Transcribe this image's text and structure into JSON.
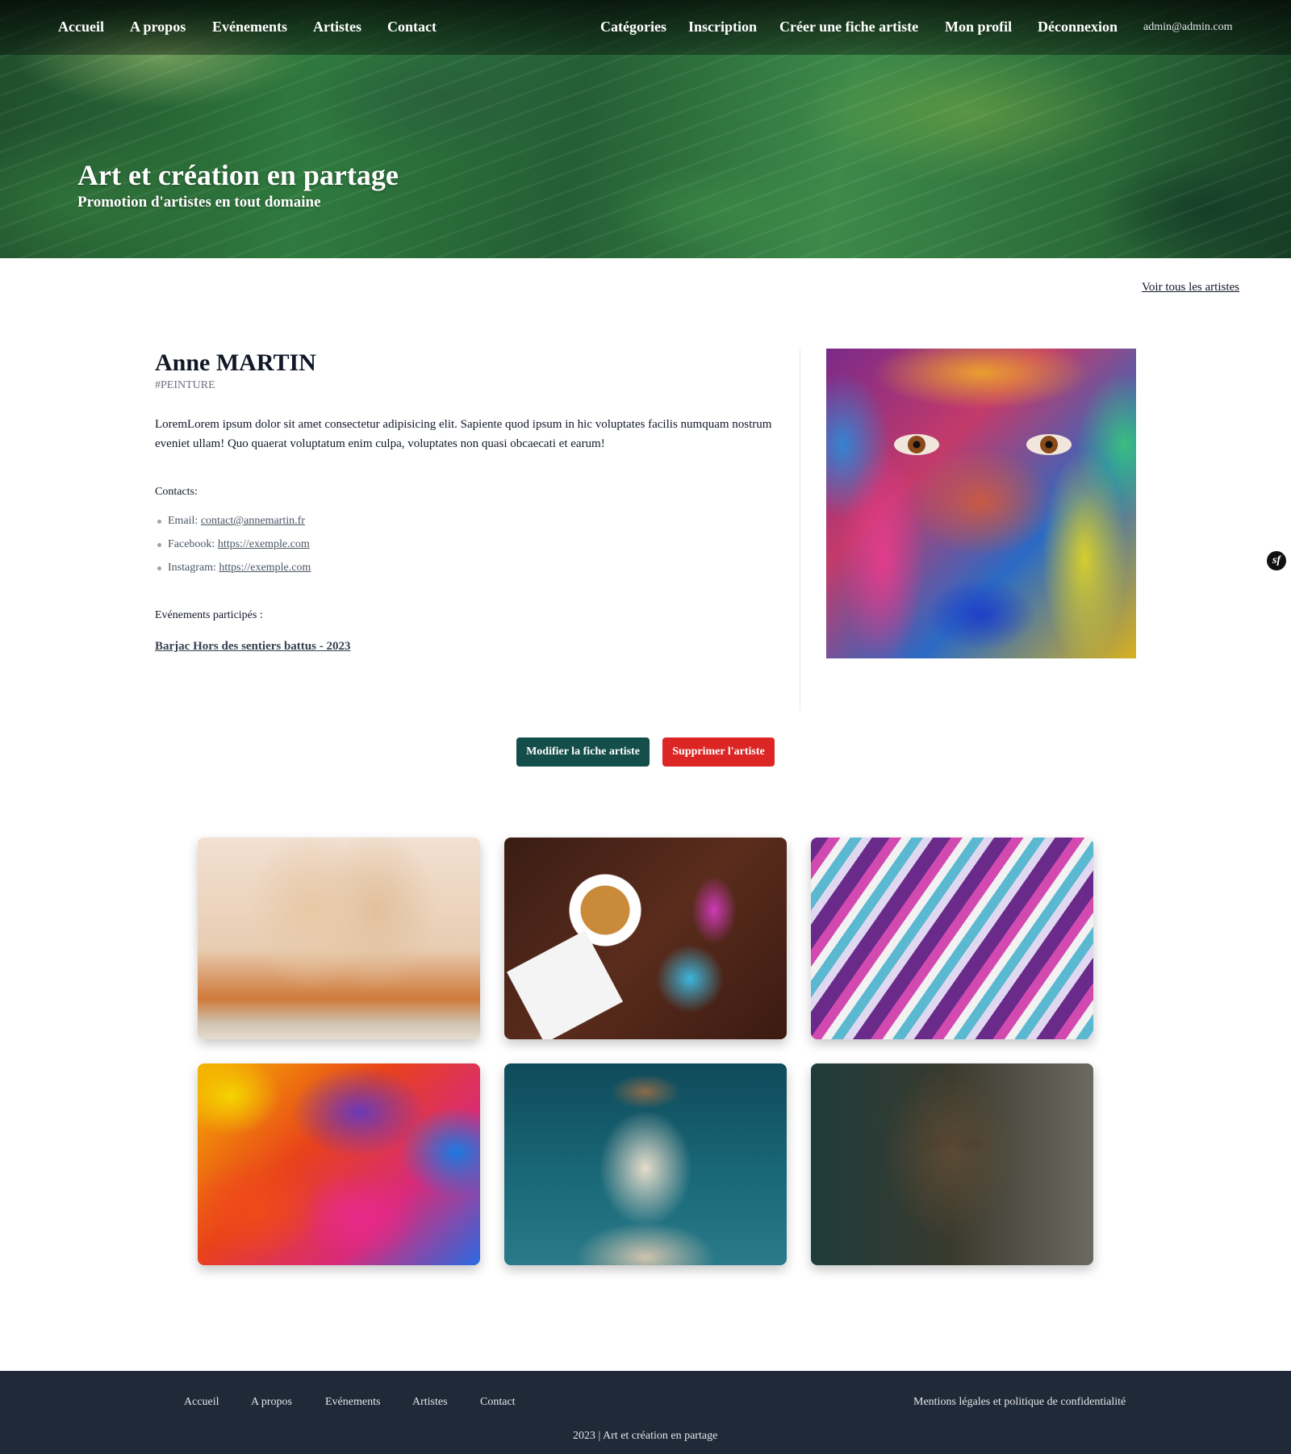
{
  "nav": {
    "left": [
      "Accueil",
      "A propos",
      "Evénements",
      "Artistes",
      "Contact"
    ],
    "right": [
      "Catégories",
      "Inscription",
      "Créer une fiche artiste",
      "Mon profil",
      "Déconnexion"
    ],
    "user_email": "admin@admin.com"
  },
  "hero": {
    "title": "Art et création en partage",
    "subtitle": "Promotion d'artistes en tout domaine"
  },
  "main": {
    "all_artists_link": "Voir tous les artistes",
    "artist": {
      "name": "Anne MARTIN",
      "tag": "#PEINTURE",
      "bio": "LoremLorem ipsum dolor sit amet consectetur adipisicing elit. Sapiente quod ipsum in hic voluptates facilis numquam nostrum eveniet ullam! Quo quaerat voluptatum enim culpa, voluptates non quasi obcaecati et earum!",
      "contacts_label": "Contacts:",
      "contacts": [
        {
          "label": "Email:",
          "value": "contact@annemartin.fr"
        },
        {
          "label": "Facebook:",
          "value": "https://exemple.com"
        },
        {
          "label": "Instagram:",
          "value": "https://exemple.com"
        }
      ],
      "events_label": "Evénements participés :",
      "events": [
        "Barjac Hors des sentiers battus - 2023"
      ]
    },
    "buttons": {
      "edit": "Modifier la fiche artiste",
      "delete": "Supprimer l'artiste"
    },
    "debug_badge": "sf"
  },
  "footer": {
    "links": [
      "Accueil",
      "A propos",
      "Evénements",
      "Artistes",
      "Contact"
    ],
    "legal": "Mentions légales et politique de confidentialité",
    "copyright": "2023 | Art et création en partage"
  },
  "colors": {
    "edit_button": "#134e4a",
    "delete_button": "#dc2626",
    "footer_bg": "#1f2937"
  }
}
